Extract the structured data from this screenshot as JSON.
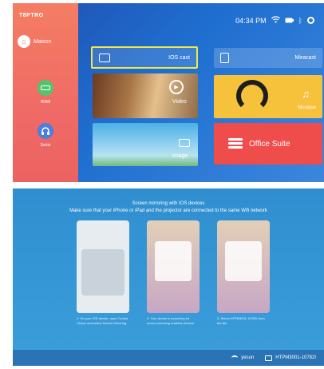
{
  "home_screen": {
    "brand": "T8PTRO",
    "home_label": "Maison",
    "sidebar": [
      {
        "icon": "hdmi-icon",
        "label": "HDMI"
      },
      {
        "icon": "headset-icon",
        "label": "Sortie"
      }
    ],
    "status": {
      "time": "04:34 PM"
    },
    "tiles": {
      "ioscast": "IOS cast",
      "miracast": "Miracast",
      "video": "Video",
      "music": "Musique",
      "image": "Image",
      "office": "Office Suite"
    }
  },
  "cast_screen": {
    "title": "Screen mirroring with IOS devices",
    "subtitle": "Make sure that your iPhone or iPad and the projector are connected to the same Wifi network",
    "steps": [
      "1. On your iOS device, open Control Center and select Screen Mirroring.",
      "2. Your device is searching for screen mirroring enabled devices.",
      "3. Select HTPM3001-10782I from the list."
    ],
    "footer": {
      "wifi": "yesun",
      "device": "HTPM3001-10782I"
    }
  },
  "colors": {
    "sidebar": "#ef6b66",
    "background": "#1f5fc0",
    "selection": "#f3e64a",
    "music": "#f6c13b",
    "office": "#ee4d4b"
  }
}
